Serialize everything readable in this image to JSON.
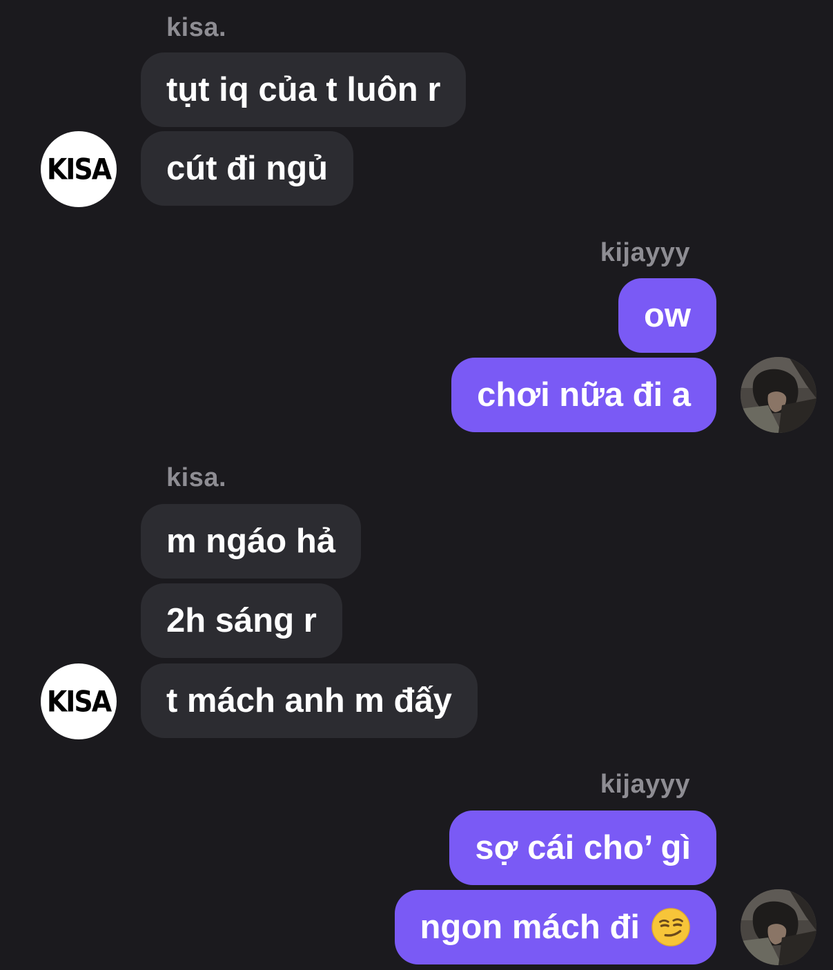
{
  "conversation": [
    {
      "sender": "kisa.",
      "direction": "in",
      "messages": [
        "tụt iq của t luôn r",
        "cút đi ngủ"
      ],
      "avatar_text": "KISA"
    },
    {
      "sender": "kijayyy",
      "direction": "out",
      "messages": [
        "ow",
        "chơi nữa đi a"
      ]
    },
    {
      "sender": "kisa.",
      "direction": "in",
      "messages": [
        "m ngáo hả",
        "2h sáng r",
        "t mách anh m đấy"
      ],
      "avatar_text": "KISA"
    },
    {
      "sender": "kijayyy",
      "direction": "out",
      "messages": [
        "sợ cái cho’ gì",
        "ngon mách đi"
      ],
      "trailing_emoji": "smirking-face-emoji"
    }
  ],
  "colors": {
    "background": "#1b1a1e",
    "incoming_bubble": "#2c2c31",
    "outgoing_bubble": "#7a5af5",
    "sender_label": "#8e8d93",
    "message_text": "#ffffff"
  }
}
